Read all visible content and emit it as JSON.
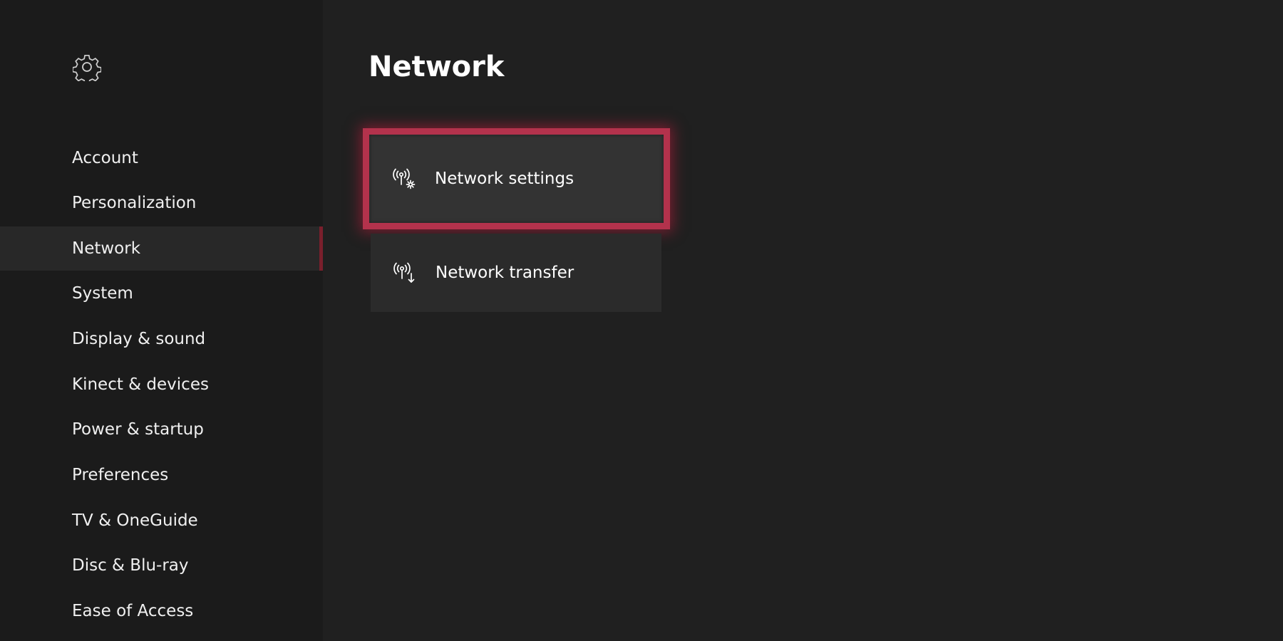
{
  "sidebar": {
    "icon": "gear-icon",
    "items": [
      {
        "label": "Account",
        "selected": false
      },
      {
        "label": "Personalization",
        "selected": false
      },
      {
        "label": "Network",
        "selected": true
      },
      {
        "label": "System",
        "selected": false
      },
      {
        "label": "Display & sound",
        "selected": false
      },
      {
        "label": "Kinect & devices",
        "selected": false
      },
      {
        "label": "Power & startup",
        "selected": false
      },
      {
        "label": "Preferences",
        "selected": false
      },
      {
        "label": "TV & OneGuide",
        "selected": false
      },
      {
        "label": "Disc & Blu-ray",
        "selected": false
      },
      {
        "label": "Ease of Access",
        "selected": false
      }
    ]
  },
  "main": {
    "title": "Network",
    "tiles": [
      {
        "label": "Network settings",
        "icon": "network-settings-icon",
        "focused": true
      },
      {
        "label": "Network transfer",
        "icon": "network-transfer-icon",
        "focused": false
      }
    ]
  },
  "colors": {
    "background": "#202020",
    "sidebar": "#1b1b1b",
    "focus_border": "#b3324c",
    "selected_indicator": "#7a1f2c"
  }
}
